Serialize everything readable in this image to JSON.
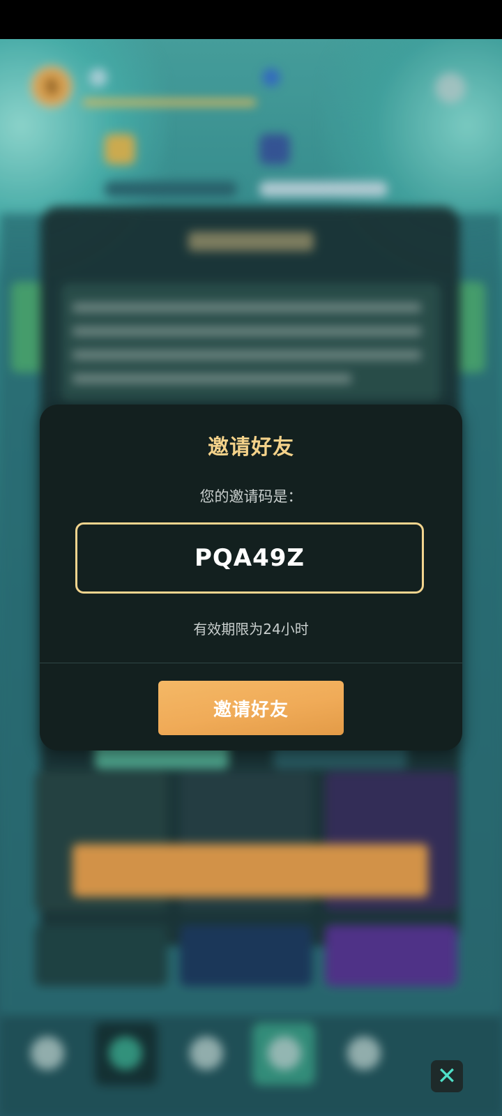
{
  "dialog": {
    "title": "邀请好友",
    "subtitle": "您的邀请码是：",
    "invite_code": "PQA49Z",
    "validity_text": "有效期限为24小时",
    "invite_button_label": "邀请好友"
  },
  "background": {
    "coin_symbol": "$"
  },
  "close_button": {
    "icon": "close-icon",
    "glyph": "✕"
  },
  "colors": {
    "accent_gold": "#f4d28a",
    "button_orange": "#f0ab58",
    "dialog_bg": "#13201f",
    "close_icon": "#4fe0c8"
  }
}
